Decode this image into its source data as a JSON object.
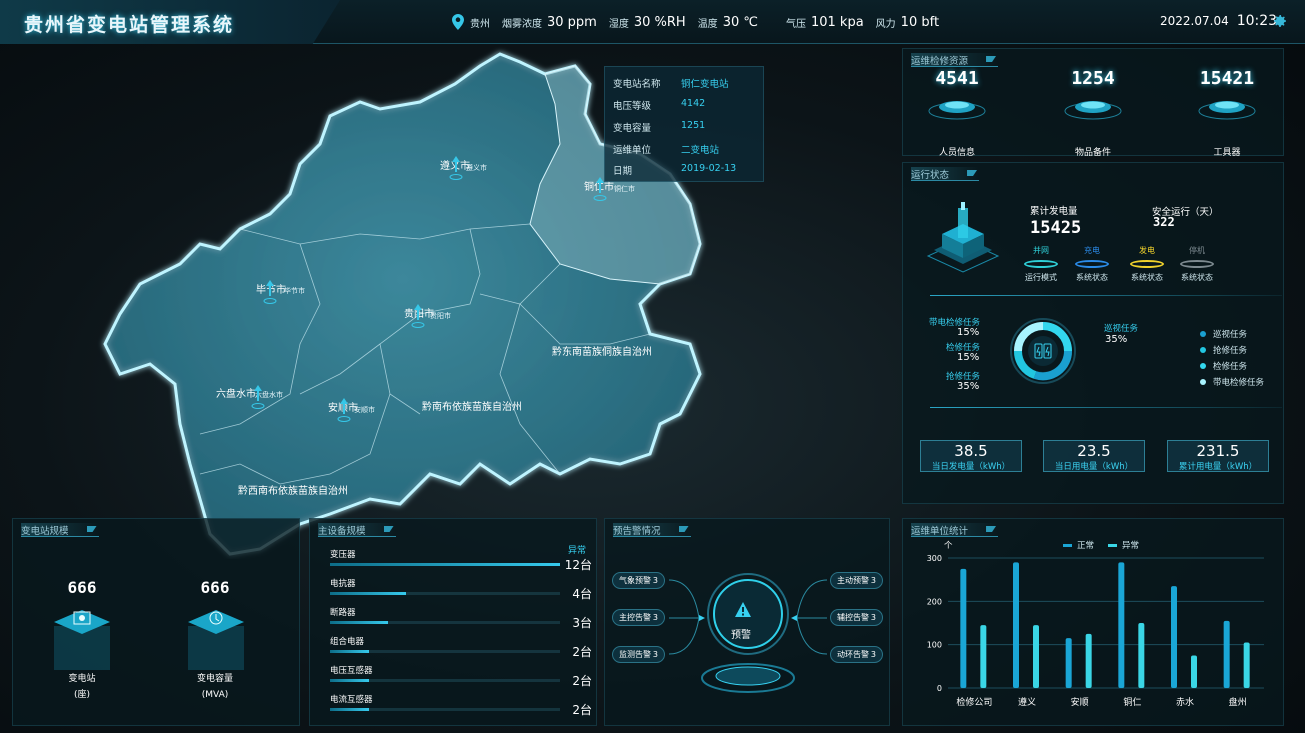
{
  "header": {
    "title": "贵州省变电站管理系统",
    "location": "贵州",
    "smoke_label": "烟雾浓度",
    "smoke_value": "30 ppm",
    "humidity_label": "湿度",
    "humidity_value": "30 %RH",
    "temp_label": "温度",
    "temp_value": "30 ℃",
    "pressure_label": "气压",
    "pressure_value": "101 kpa",
    "wind_label": "风力",
    "wind_value": "10 bft",
    "date": "2022.07.04",
    "time": "10:23"
  },
  "map": {
    "regions": [
      "遵义市",
      "铜仁市",
      "毕节市",
      "贵阳市",
      "黔东南苗族侗族自治州",
      "六盘水市",
      "安顺市",
      "黔南布依族苗族自治州",
      "黔西南布依族苗族自治州"
    ],
    "small_labels": [
      "遵义市",
      "铜仁市",
      "毕节市",
      "贵阳市",
      "六盘水市",
      "安顺市"
    ],
    "info": {
      "name_label": "变电站名称",
      "name": "铜仁变电站",
      "voltage_label": "电压等级",
      "voltage": "4142",
      "capacity_label": "变电容量",
      "capacity": "1251",
      "unit_label": "运维单位",
      "unit": "二变电站",
      "date_label": "日期",
      "date": "2019-02-13"
    }
  },
  "resources": {
    "title": "运维检修资源",
    "items": [
      {
        "value": "4541",
        "label": "人员信息"
      },
      {
        "value": "1254",
        "label": "物品备件"
      },
      {
        "value": "15421",
        "label": "工具器"
      }
    ]
  },
  "status": {
    "title": "运行状态",
    "total_label": "累计发电量",
    "total_value": "15425",
    "safe_label": "安全运行（天）",
    "safe_value": "322",
    "modes": [
      {
        "top": "并网",
        "bottom": "运行模式",
        "color": "#2fd0d8"
      },
      {
        "top": "充电",
        "bottom": "系统状态",
        "color": "#2b8be8"
      },
      {
        "top": "发电",
        "bottom": "系统状态",
        "color": "#f1d22c"
      },
      {
        "top": "停机",
        "bottom": "系统状态",
        "color": "#7d8a90"
      }
    ],
    "tasks": {
      "left": [
        {
          "label": "带电检修任务",
          "pct": "15%"
        },
        {
          "label": "检修任务",
          "pct": "15%"
        },
        {
          "label": "抢修任务",
          "pct": "35%"
        }
      ],
      "right": {
        "label": "巡视任务",
        "pct": "35%"
      },
      "legend": [
        "巡视任务",
        "抢修任务",
        "检修任务",
        "带电检修任务"
      ]
    },
    "kpis": [
      {
        "value": "38.5",
        "label": "当日发电量（kWh）"
      },
      {
        "value": "23.5",
        "label": "当日用电量（kWh）"
      },
      {
        "value": "231.5",
        "label": "累计用电量（kWh）"
      }
    ]
  },
  "scale": {
    "title": "变电站规模",
    "items": [
      {
        "value": "666",
        "label": "变电站",
        "unit": "(座)"
      },
      {
        "value": "666",
        "label": "变电容量",
        "unit": "(MVA)"
      }
    ]
  },
  "equipment": {
    "title": "主设备规模",
    "abnormal_label": "异常",
    "items": [
      {
        "name": "变压器",
        "value": "12台",
        "fill": 1.0
      },
      {
        "name": "电抗器",
        "value": "4台",
        "fill": 0.33
      },
      {
        "name": "断路器",
        "value": "3台",
        "fill": 0.25
      },
      {
        "name": "组合电器",
        "value": "2台",
        "fill": 0.17
      },
      {
        "name": "电压互感器",
        "value": "2台",
        "fill": 0.17
      },
      {
        "name": "电流互感器",
        "value": "2台",
        "fill": 0.17
      }
    ]
  },
  "alerts": {
    "title": "预告警情况",
    "center_label": "预警",
    "left": [
      {
        "label": "气象预警",
        "count": "3"
      },
      {
        "label": "主控告警",
        "count": "3"
      },
      {
        "label": "监测告警",
        "count": "3"
      }
    ],
    "right": [
      {
        "label": "主动预警",
        "count": "3"
      },
      {
        "label": "辅控告警",
        "count": "3"
      },
      {
        "label": "动环告警",
        "count": "3"
      }
    ]
  },
  "ops": {
    "title": "运维单位统计",
    "unit_label": "个",
    "chart_data": {
      "type": "bar",
      "categories": [
        "检修公司",
        "遵义",
        "安顺",
        "铜仁",
        "赤水",
        "盘州"
      ],
      "series": [
        {
          "name": "正常",
          "values": [
            275,
            290,
            115,
            290,
            235,
            155
          ],
          "color": "#1aa6d6"
        },
        {
          "name": "异常",
          "values": [
            145,
            145,
            125,
            150,
            75,
            105
          ],
          "color": "#3ad6e6"
        }
      ],
      "yticks": [
        "0",
        "100",
        "200",
        "300"
      ],
      "ylim": [
        0,
        300
      ]
    }
  }
}
